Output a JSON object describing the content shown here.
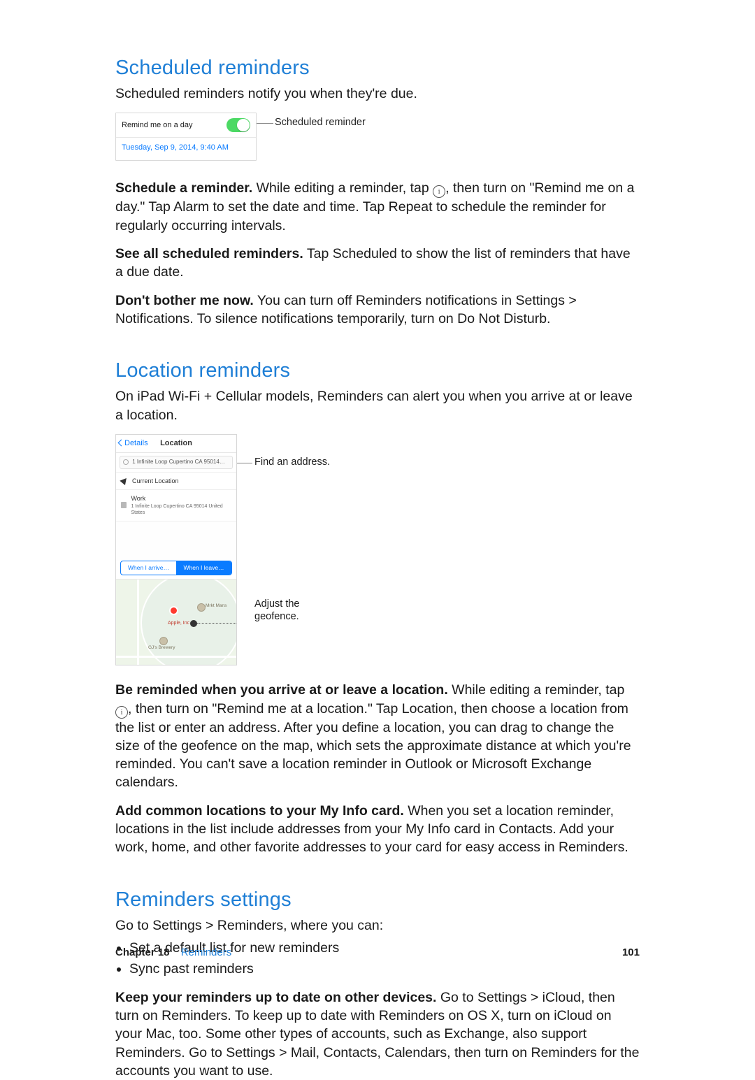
{
  "sections": {
    "scheduled": {
      "title": "Scheduled reminders",
      "intro": "Scheduled reminders notify you when they're due.",
      "fig": {
        "row_label": "Remind me on a day",
        "date_text": "Tuesday, Sep 9, 2014, 9:40 AM",
        "callout": "Scheduled reminder"
      },
      "p1_bold": "Schedule a reminder.",
      "p1_rest": " While editing a reminder, tap ",
      "p1_after": ", then turn on \"Remind me on a day.\" Tap Alarm to set the date and time. Tap Repeat to schedule the reminder for regularly occurring intervals.",
      "p2_bold": "See all scheduled reminders.",
      "p2_rest": " Tap Scheduled to show the list of reminders that have a due date.",
      "p3_bold": "Don't bother me now.",
      "p3_rest": " You can turn off Reminders notifications in Settings > Notifications. To silence notifications temporarily, turn on Do Not Disturb."
    },
    "location": {
      "title": "Location reminders",
      "intro": "On iPad Wi-Fi + Cellular models, Reminders can alert you when you arrive at or leave a location.",
      "fig": {
        "back": "Details",
        "header": "Location",
        "search_text": "1 Infinite Loop Cupertino CA 95014…",
        "item_current": "Current Location",
        "item_work": "Work",
        "item_work_sub": "1 Infinite Loop Cupertino CA 95014 United States",
        "seg_arrive": "When I arrive…",
        "seg_leave": "When I leave…",
        "pin_label": "Apple, Inc",
        "poi_a": "Mrkt Mans",
        "poi_b": "GJ's Brewery",
        "callout_find": "Find an address.",
        "callout_geo_l1": "Adjust the",
        "callout_geo_l2": "geofence."
      },
      "p1_bold": "Be reminded when you arrive at or leave a location.",
      "p1_rest": " While editing a reminder, tap ",
      "p1_after": ", then turn on \"Remind me at a location.\" Tap Location, then choose a location from the list or enter an address. After you define a location, you can drag to change the size of the geofence on the map, which sets the approximate distance at which you're reminded. You can't save a location reminder in Outlook or Microsoft Exchange calendars.",
      "p2_bold": "Add common locations to your My Info card.",
      "p2_rest": " When you set a location reminder, locations in the list include addresses from your My Info card in Contacts. Add your work, home, and other favorite addresses to your card for easy access in Reminders."
    },
    "settings": {
      "title": "Reminders settings",
      "intro": "Go to Settings > Reminders, where you can:",
      "bullets": [
        "Set a default list for new reminders",
        "Sync past reminders"
      ],
      "p1_bold": "Keep your reminders up to date on other devices.",
      "p1_rest": " Go to Settings > iCloud, then turn on Reminders. To keep up to date with Reminders on OS X, turn on iCloud on your Mac, too. Some other types of accounts, such as Exchange, also support Reminders. Go to Settings > Mail, Contacts, Calendars, then turn on Reminders for the accounts you want to use."
    }
  },
  "footer": {
    "chapter_label": "Chapter  18",
    "chapter_name": "Reminders",
    "page_number": "101"
  }
}
